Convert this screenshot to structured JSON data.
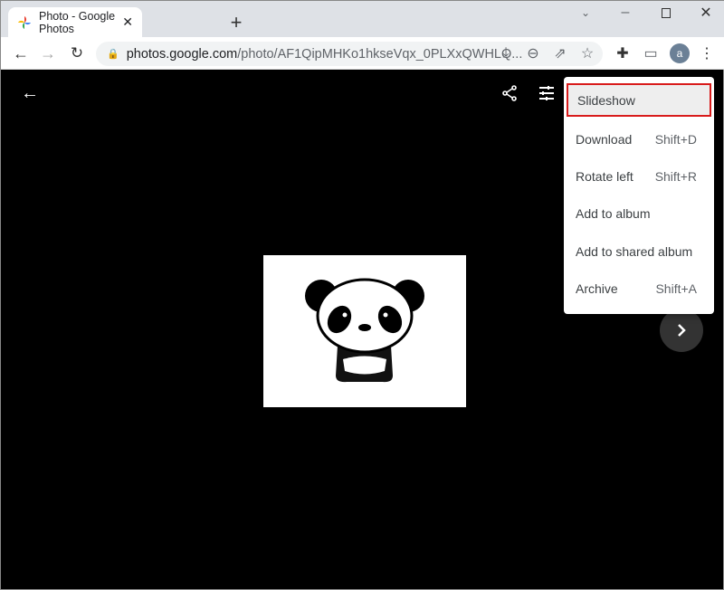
{
  "browser": {
    "tab_title": "Photo - Google Photos",
    "url_host": "photos.google.com",
    "url_path": "/photo/AF1QipMHKo1hkseVqx_0PLXxQWHLQ...",
    "avatar_letter": "a"
  },
  "viewer": {
    "menu_items": [
      {
        "label": "Slideshow",
        "shortcut": ""
      },
      {
        "label": "Download",
        "shortcut": "Shift+D"
      },
      {
        "label": "Rotate left",
        "shortcut": "Shift+R"
      },
      {
        "label": "Add to album",
        "shortcut": ""
      },
      {
        "label": "Add to shared album",
        "shortcut": ""
      },
      {
        "label": "Archive",
        "shortcut": "Shift+A"
      }
    ],
    "highlight_color": "#d81b1b"
  }
}
